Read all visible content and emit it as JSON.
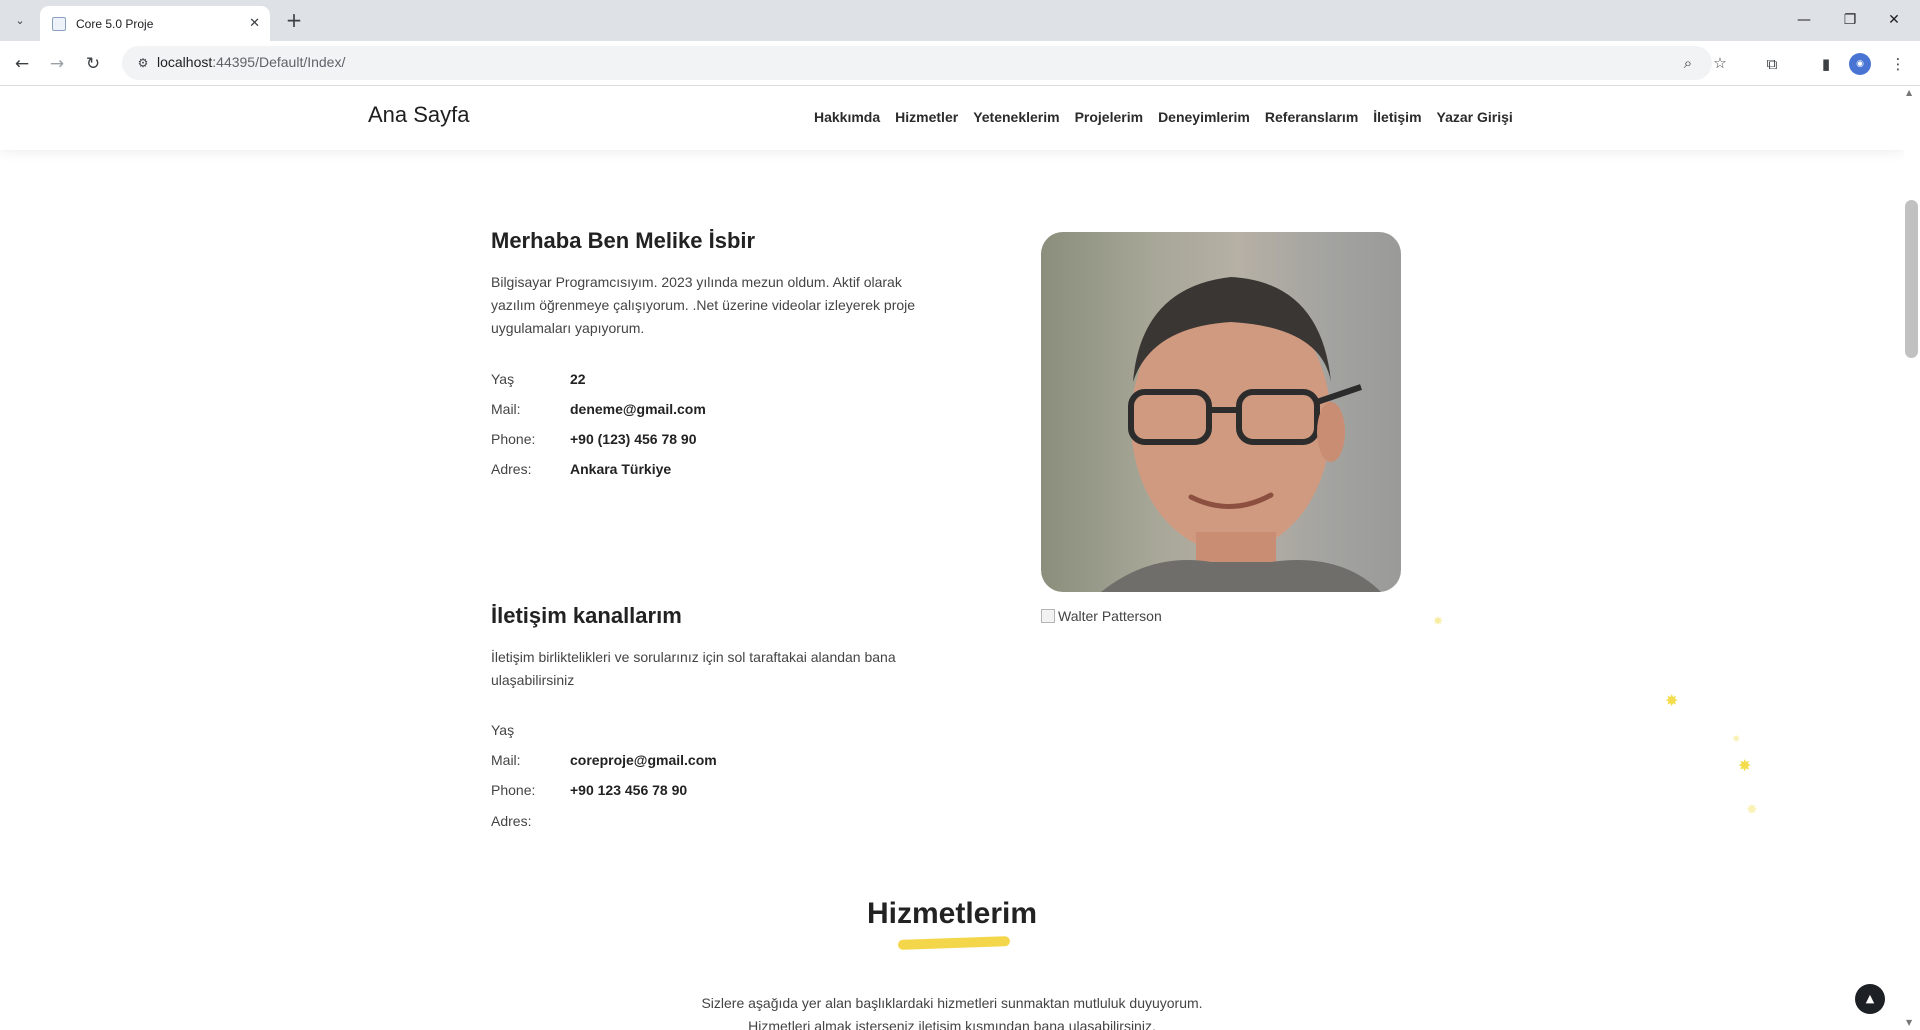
{
  "browser": {
    "tab_title": "Core 5.0 Proje",
    "url_host": "localhost",
    "url_path": ":44395/Default/Index/",
    "tab_close": "✕",
    "new_tab": "+",
    "dropdown": "⌄",
    "minimize": "—",
    "restore": "❐",
    "close": "✕"
  },
  "site": {
    "brand": "Ana Sayfa",
    "menu": [
      "Hakkımda",
      "Hizmetler",
      "Yeteneklerim",
      "Projelerim",
      "Deneyimlerim",
      "Referanslarım",
      "İletişim",
      "Yazar Girişi"
    ]
  },
  "about": {
    "title": "Merhaba Ben Melike İsbir",
    "text": "Bilgisayar Programcısıyım. 2023 yılında mezun oldum. Aktif olarak yazılım öğrenmeye çalışıyorum. .Net üzerine videolar izleyerek proje uygulamaları yapıyorum.",
    "rows": [
      {
        "k": "Yaş",
        "v": "22"
      },
      {
        "k": "Mail:",
        "v": "deneme@gmail.com"
      },
      {
        "k": "Phone:",
        "v": "+90 (123) 456 78 90"
      },
      {
        "k": "Adres:",
        "v": "Ankara Türkiye"
      }
    ],
    "photo_alt": "Walter Patterson"
  },
  "contact": {
    "title": "İletişim kanallarım",
    "text": "İletişim birliktelikleri ve sorularınız için sol taraftakai alandan bana ulaşabilirsiniz",
    "rows": [
      {
        "k": "Yaş",
        "v": ""
      },
      {
        "k": "Mail:",
        "v": "coreproje@gmail.com"
      },
      {
        "k": "Phone:",
        "v": "+90 123 456 78 90"
      },
      {
        "k": "Adres:",
        "v": ""
      }
    ]
  },
  "services": {
    "title": "Hizmetlerim",
    "line1": "Sizlere aşağıda yer alan başlıklardaki hizmetleri sunmaktan mutluluk duyuyorum.",
    "line2": "Hizmetleri almak isterseniz iletişim kısmından bana ulaşabilirsiniz."
  },
  "colors": {
    "accent": "#f4d64a",
    "dark": "#1d2125"
  },
  "icons": {
    "to_top": "chevron-up-icon"
  }
}
